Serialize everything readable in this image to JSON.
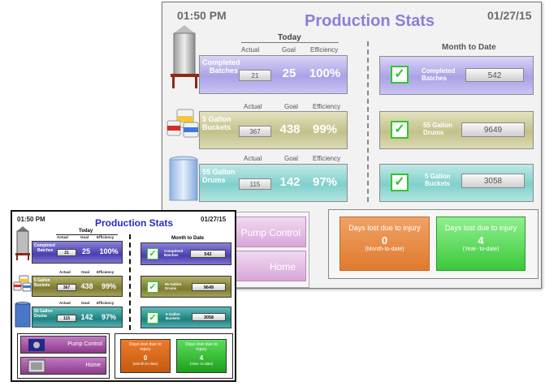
{
  "window_large": {
    "time": "01:50 PM",
    "title": "Production Stats",
    "date": "01/27/15",
    "today_heading": "Today",
    "column_headers": [
      "Actual",
      "Goal",
      "Efficiency"
    ],
    "rows": [
      {
        "label_line1": "Completed",
        "label_line2": "Batches",
        "actual": "21",
        "goal": "25",
        "efficiency": "100%"
      },
      {
        "label_line1": "5 Gallon",
        "label_line2": "Buckets",
        "actual": "367",
        "goal": "438",
        "efficiency": "99%"
      },
      {
        "label_line1": "55 Gallon",
        "label_line2": "Drums",
        "actual": "115",
        "goal": "142",
        "efficiency": "97%"
      }
    ],
    "month_to_date_heading": "Month to Date",
    "mtd_rows": [
      {
        "label_line1": "Completed",
        "label_line2": "Batches",
        "value": "542"
      },
      {
        "label_line1": "55 Gallon",
        "label_line2": "Drums",
        "value": "9649"
      },
      {
        "label_line1": "5 Gallon",
        "label_line2": "Buckets",
        "value": "3058"
      }
    ],
    "nav": {
      "pump_control": "Pump Control",
      "home": "Home"
    },
    "days_lost_month": {
      "title": "Days lost due to injury",
      "value": "0",
      "caption": "(Month-to-date)"
    },
    "days_lost_year": {
      "title": "Days lost due to injury",
      "value": "4",
      "caption": "(Year- to-date)"
    }
  },
  "window_small": {
    "time": "01:50 PM",
    "title": "Production Stats",
    "date": "01/27/15",
    "today_heading": "Today",
    "column_headers": [
      "Actual",
      "Goal",
      "Efficiency"
    ],
    "rows": [
      {
        "label_line1": "Completed",
        "label_line2": "Batches",
        "actual": "21",
        "goal": "25",
        "efficiency": "100%"
      },
      {
        "label_line1": "5 Gallon",
        "label_line2": "Buckets",
        "actual": "367",
        "goal": "438",
        "efficiency": "99%"
      },
      {
        "label_line1": "55 Gallon",
        "label_line2": "Drums",
        "actual": "115",
        "goal": "142",
        "efficiency": "97%"
      }
    ],
    "month_to_date_heading": "Month to Date",
    "mtd_rows": [
      {
        "label_line1": "Completed",
        "label_line2": "Batches",
        "value": "542"
      },
      {
        "label_line1": "55 Gallon",
        "label_line2": "Drums",
        "value": "9649"
      },
      {
        "label_line1": "5 Gallon",
        "label_line2": "Buckets",
        "value": "3058"
      }
    ],
    "nav": {
      "pump_control": "Pump Control",
      "home": "Home"
    },
    "days_lost_month": {
      "title": "Days lost due to injury",
      "value": "0",
      "caption": "(Month-to-date)"
    },
    "days_lost_year": {
      "title": "Days lost due to injury",
      "value": "4",
      "caption": "(Year- to-date)"
    }
  },
  "colors": {
    "title_large": "#8a7fd8",
    "title_small": "#2a2acc",
    "check_green": "#2fc62f",
    "injury_orange": "#e07a2e",
    "injury_green": "#3cc83c"
  },
  "icons": [
    "tank-icon",
    "buckets-icon",
    "drum-icon",
    "checkmark-icon",
    "pump-icon",
    "home-machine-icon"
  ]
}
